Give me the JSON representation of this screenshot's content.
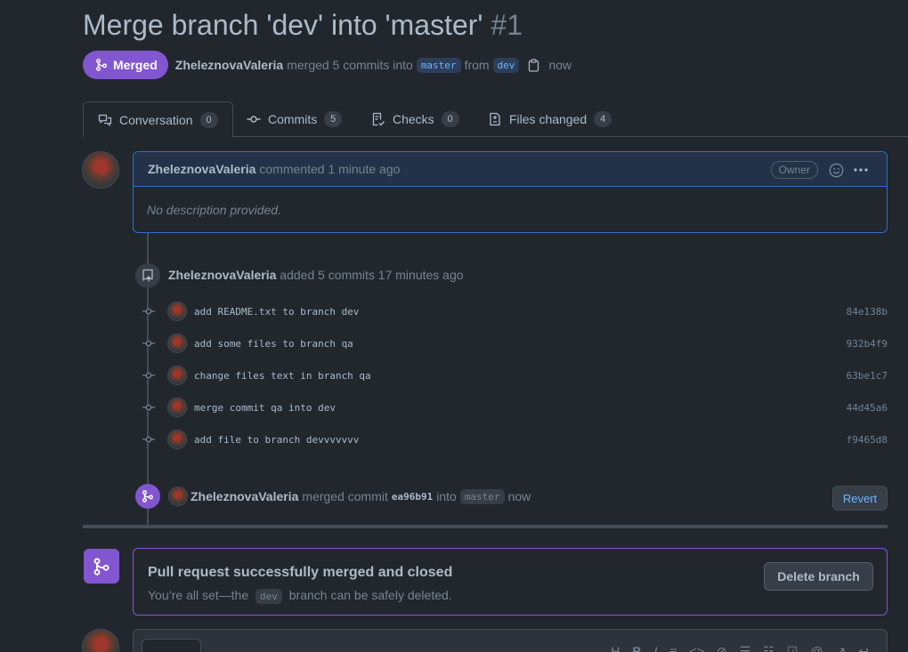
{
  "header": {
    "title": "Merge branch 'dev' into 'master'",
    "number": "#1",
    "state_label": "Merged",
    "author": "ZheleznovaValeria",
    "merged_text": "merged 5 commits into",
    "base_branch": "master",
    "from_text": "from",
    "head_branch": "dev",
    "time": "now"
  },
  "tabs": [
    {
      "label": "Conversation",
      "count": "0"
    },
    {
      "label": "Commits",
      "count": "5"
    },
    {
      "label": "Checks",
      "count": "0"
    },
    {
      "label": "Files changed",
      "count": "4"
    }
  ],
  "comment": {
    "author": "ZheleznovaValeria",
    "action": "commented 1 minute ago",
    "role_badge": "Owner",
    "body": "No description provided."
  },
  "commits_event": {
    "author": "ZheleznovaValeria",
    "text": "added 5 commits 17 minutes ago",
    "commits": [
      {
        "message": "add README.txt to branch dev",
        "sha": "84e138b"
      },
      {
        "message": "add some files to branch qa",
        "sha": "932b4f9"
      },
      {
        "message": "change files text in branch qa",
        "sha": "63be1c7"
      },
      {
        "message": "merge commit qa into dev",
        "sha": "44d45a6"
      },
      {
        "message": "add file to branch devvvvvvv",
        "sha": "f9465d8"
      }
    ]
  },
  "merge_event": {
    "author": "ZheleznovaValeria",
    "text": "merged commit",
    "sha": "ea96b91",
    "into_text": "into",
    "branch": "master",
    "time": "now",
    "revert_label": "Revert"
  },
  "merge_status": {
    "title": "Pull request successfully merged and closed",
    "sub_before": "You’re all set—the",
    "branch": "dev",
    "sub_after": "branch can be safely deleted.",
    "delete_label": "Delete branch"
  },
  "colors": {
    "background": "#22272e",
    "merged_purple": "#8256d0",
    "comment_border": "#316dca",
    "link_blue": "#6cb6ff"
  }
}
